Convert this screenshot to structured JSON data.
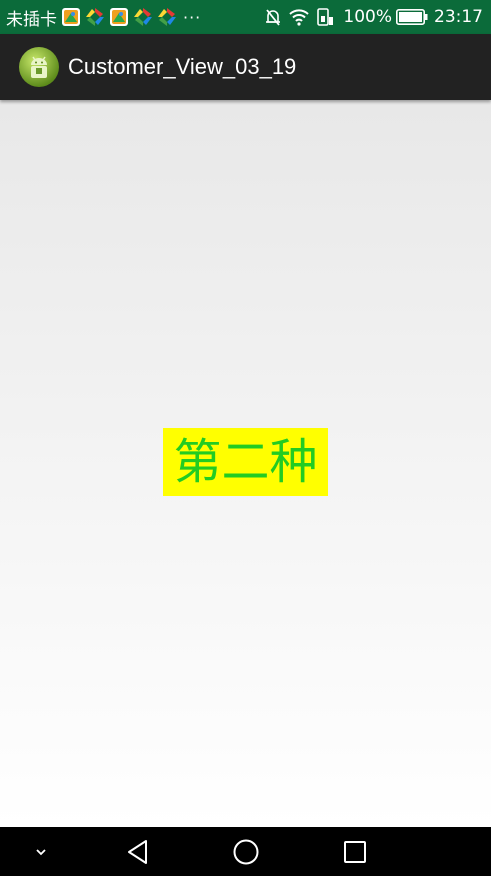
{
  "status_bar": {
    "carrier": "未插卡",
    "more": "···",
    "battery": "100%",
    "time": "23:17",
    "notifications": [
      "app-notification-icon",
      "sync-notification-icon",
      "app-notification-icon",
      "sync-notification-icon",
      "sync-notification-icon"
    ]
  },
  "action_bar": {
    "title": "Customer_View_03_19"
  },
  "content": {
    "custom_view_text": "第二种"
  },
  "nav_bar": {
    "buttons": [
      "collapse-icon",
      "back-icon",
      "home-icon",
      "recents-icon"
    ]
  },
  "colors": {
    "status_bar_bg": "#0b6b3a",
    "action_bar_bg": "#222222",
    "custom_view_bg": "#ffff00",
    "custom_view_text": "#22cc22",
    "nav_bar_bg": "#000000"
  }
}
